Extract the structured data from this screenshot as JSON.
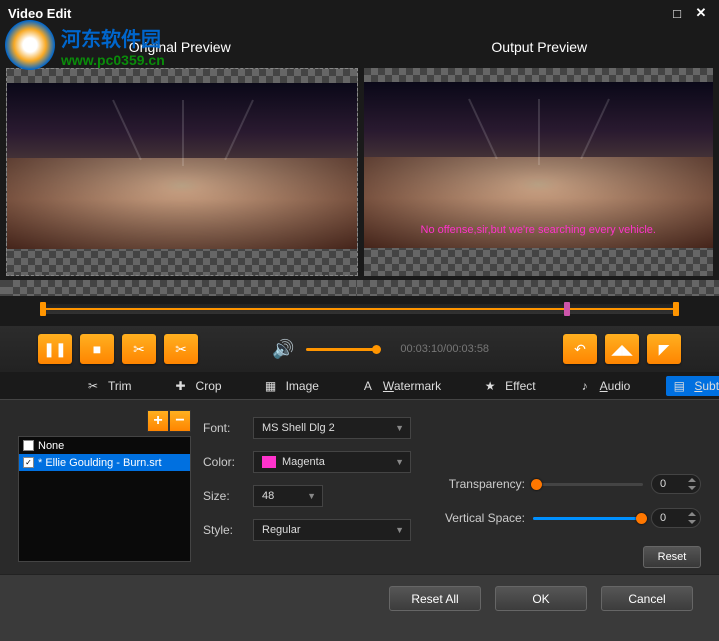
{
  "title": "Video Edit",
  "logo": {
    "chinese": "河东软件园",
    "url": "www.pc0359.cn"
  },
  "preview": {
    "original": "Original Preview",
    "output": "Output Preview"
  },
  "subtitle_preview": "No offense,sir,but we're searching every vehicle.",
  "timecode": "00:03:10/00:03:58",
  "tabs": {
    "trim": "Trim",
    "crop": "Crop",
    "image": "Image",
    "watermark": "Watermark",
    "effect": "Effect",
    "audio": "Audio",
    "subtitle": "Subtitle"
  },
  "subtitle_list": {
    "items": [
      {
        "checked": false,
        "label": "None"
      },
      {
        "checked": true,
        "label": "* Ellie Goulding - Burn.srt"
      }
    ]
  },
  "fields": {
    "font": {
      "label": "Font:",
      "value": "MS Shell Dlg 2"
    },
    "color": {
      "label": "Color:",
      "value": "Magenta",
      "swatch": "#ff33cc"
    },
    "size": {
      "label": "Size:",
      "value": "48"
    },
    "style": {
      "label": "Style:",
      "value": "Regular"
    },
    "transparency": {
      "label": "Transparency:",
      "value": "0"
    },
    "vspace": {
      "label": "Vertical Space:",
      "value": "0"
    }
  },
  "buttons": {
    "reset": "Reset",
    "reset_all": "Reset All",
    "ok": "OK",
    "cancel": "Cancel",
    "add": "+",
    "remove": "−"
  }
}
